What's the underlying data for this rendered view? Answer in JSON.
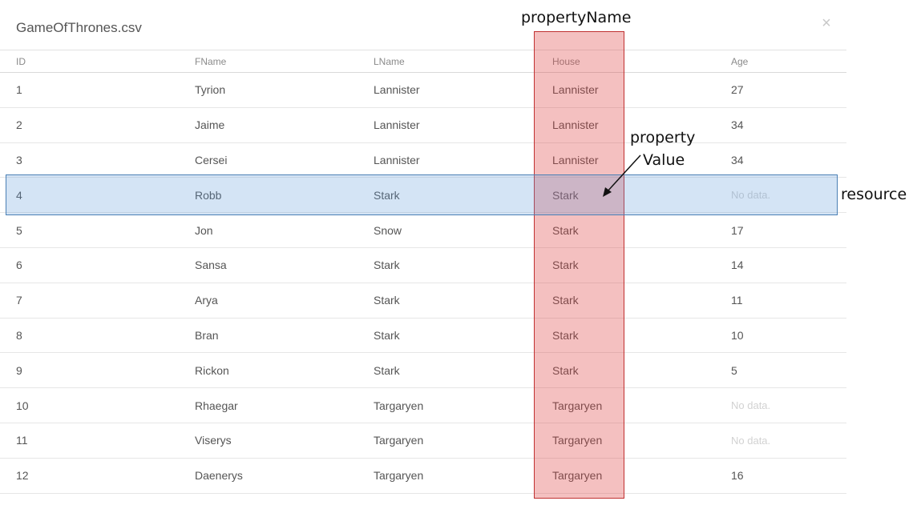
{
  "dialog": {
    "title": "GameOfThrones.csv",
    "close_glyph": "×"
  },
  "table": {
    "columns": [
      "ID",
      "FName",
      "LName",
      "House",
      "Age"
    ],
    "rows": [
      [
        "1",
        "Tyrion",
        "Lannister",
        "Lannister",
        "27"
      ],
      [
        "2",
        "Jaime",
        "Lannister",
        "Lannister",
        "34"
      ],
      [
        "3",
        "Cersei",
        "Lannister",
        "Lannister",
        "34"
      ],
      [
        "4",
        "Robb",
        "Stark",
        "Stark",
        "No data."
      ],
      [
        "5",
        "Jon",
        "Snow",
        "Stark",
        "17"
      ],
      [
        "6",
        "Sansa",
        "Stark",
        "Stark",
        "14"
      ],
      [
        "7",
        "Arya",
        "Stark",
        "Stark",
        "11"
      ],
      [
        "8",
        "Bran",
        "Stark",
        "Stark",
        "10"
      ],
      [
        "9",
        "Rickon",
        "Stark",
        "Stark",
        "5"
      ],
      [
        "10",
        "Rhaegar",
        "Targaryen",
        "Targaryen",
        "No data."
      ],
      [
        "11",
        "Viserys",
        "Targaryen",
        "Targaryen",
        "No data."
      ],
      [
        "12",
        "Daenerys",
        "Targaryen",
        "Targaryen",
        "16"
      ]
    ]
  },
  "annotations": {
    "property_name": "propertyName",
    "property_value_line1": "property",
    "property_value_line2": "Value",
    "resource": "resource"
  },
  "colors": {
    "column_highlight": "#dc3c3c",
    "row_highlight": "#5a96d7",
    "no_data_text": "#d2d2d2"
  }
}
